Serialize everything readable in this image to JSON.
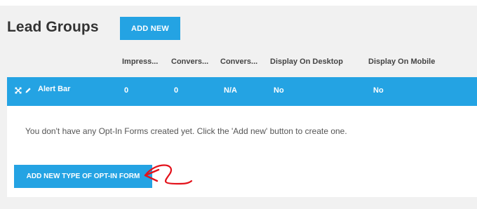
{
  "page": {
    "title": "Lead Groups",
    "add_new_label": "ADD NEW"
  },
  "table": {
    "columns": [
      "Impress...",
      "Convers...",
      "Convers...",
      "Display On Desktop",
      "Display On Mobile"
    ],
    "rows": [
      {
        "name": "Alert Bar",
        "cells": [
          "0",
          "0",
          "N/A",
          "No",
          "No"
        ]
      }
    ]
  },
  "empty_state": {
    "message": "You don't have any Opt-In Forms created yet. Click the 'Add new' button to create one.",
    "button_label": "ADD NEW TYPE OF OPT-IN FORM"
  },
  "colors": {
    "accent": "#24a3e3",
    "annotation": "#e3121b"
  },
  "icons": {
    "row_expand": "expand-arrows-icon",
    "row_edit": "pencil-icon",
    "annotation": "red-arrow-icon"
  }
}
